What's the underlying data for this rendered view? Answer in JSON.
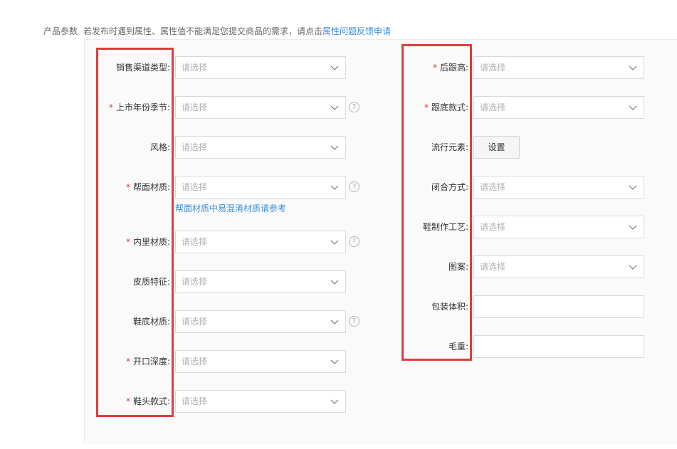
{
  "header": {
    "section_label": "产品参数",
    "description": "若发布时遇到属性、属性值不能满足您提交商品的需求，请点击",
    "feedback_link": "属性问题反馈申请"
  },
  "placeholder": "请选择",
  "required_mark": "*",
  "help_icon_glyph": "?",
  "left_fields": [
    {
      "label": "销售渠道类型:",
      "required": false,
      "help": false
    },
    {
      "label": "上市年份季节:",
      "required": true,
      "help": true
    },
    {
      "label": "风格:",
      "required": false,
      "help": false
    },
    {
      "label": "帮面材质:",
      "required": true,
      "help": true,
      "hint": "帮面材质中易混淆材质请参考"
    },
    {
      "label": "内里材质:",
      "required": true,
      "help": true
    },
    {
      "label": "皮质特征:",
      "required": false,
      "help": false
    },
    {
      "label": "鞋底材质:",
      "required": false,
      "help": true
    },
    {
      "label": "开口深度:",
      "required": true,
      "help": false
    },
    {
      "label": "鞋头款式:",
      "required": true,
      "help": false
    }
  ],
  "right_fields": [
    {
      "label": "后跟高:",
      "required": true,
      "type": "select"
    },
    {
      "label": "跟底款式:",
      "required": true,
      "type": "select"
    },
    {
      "label": "流行元素:",
      "required": false,
      "type": "button",
      "button_label": "设置"
    },
    {
      "label": "闭合方式:",
      "required": false,
      "type": "select"
    },
    {
      "label": "鞋制作工艺:",
      "required": false,
      "type": "select"
    },
    {
      "label": "图案:",
      "required": false,
      "type": "select"
    },
    {
      "label": "包装体积:",
      "required": false,
      "type": "input",
      "value": ""
    },
    {
      "label": "毛重:",
      "required": false,
      "type": "input",
      "value": ""
    }
  ],
  "colors": {
    "highlight_box": "#e23b3b",
    "link": "#3d8fd6",
    "required": "#e4393c"
  }
}
